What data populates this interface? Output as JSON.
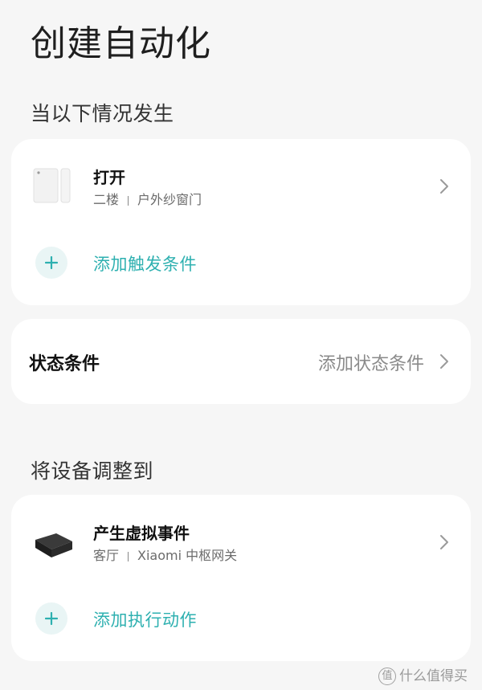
{
  "header": {
    "title": "创建自动化"
  },
  "trigger_section": {
    "title": "当以下情况发生",
    "device": {
      "name": "打开",
      "room": "二楼",
      "device_name": "户外纱窗门",
      "icon": "door-window-sensor-icon"
    },
    "add_label": "添加触发条件"
  },
  "state_section": {
    "label": "状态条件",
    "action": "添加状态条件"
  },
  "action_section": {
    "title": "将设备调整到",
    "device": {
      "name": "产生虚拟事件",
      "room": "客厅",
      "device_name": "Xiaomi 中枢网关",
      "icon": "hub-gateway-icon"
    },
    "add_label": "添加执行动作"
  },
  "watermark": {
    "text": "什么值得买",
    "logo_char": "值"
  },
  "colors": {
    "accent": "#2eb0b0",
    "background": "#f6f6f6",
    "card": "#ffffff"
  }
}
